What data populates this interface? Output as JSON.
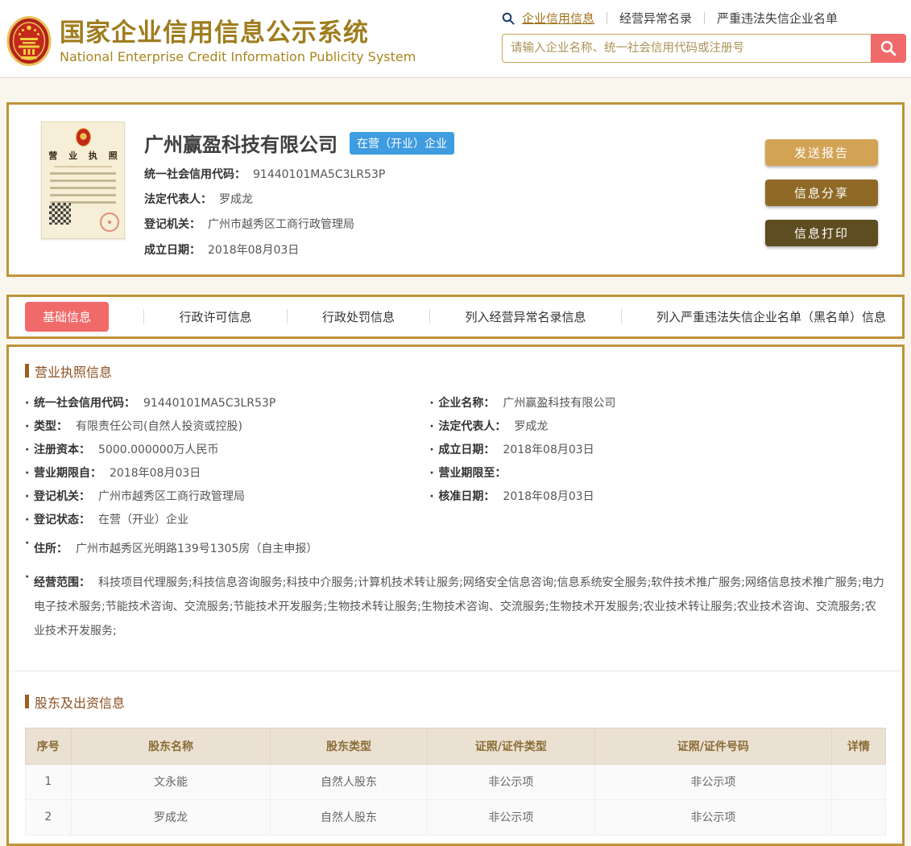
{
  "header": {
    "site_title": "国家企业信用信息公示系统",
    "site_subtitle": "National Enterprise Credit Information Publicity System",
    "nav_links": [
      {
        "label": "企业信用信息",
        "active": true
      },
      {
        "label": "经营异常名录",
        "active": false
      },
      {
        "label": "严重违法失信企业名单",
        "active": false
      }
    ],
    "search": {
      "placeholder": "请输入企业名称、统一社会信用代码或注册号"
    }
  },
  "company_card": {
    "license_title": "营 业 执 照",
    "company_name": "广州赢盈科技有限公司",
    "status_badge": "在营（开业）企业",
    "fields": [
      {
        "label": "统一社会信用代码：",
        "value": "91440101MA5C3LR53P"
      },
      {
        "label": "法定代表人：",
        "value": "罗成龙"
      },
      {
        "label": "登记机关：",
        "value": "广州市越秀区工商行政管理局"
      },
      {
        "label": "成立日期：",
        "value": "2018年08月03日"
      }
    ],
    "buttons": {
      "send_report": "发送报告",
      "share_info": "信息分享",
      "print_info": "信息打印"
    }
  },
  "tabs": [
    {
      "label": "基础信息",
      "active": true
    },
    {
      "label": "行政许可信息",
      "active": false
    },
    {
      "label": "行政处罚信息",
      "active": false
    },
    {
      "label": "列入经营异常名录信息",
      "active": false
    },
    {
      "label": "列入严重违法失信企业名单（黑名单）信息",
      "active": false
    }
  ],
  "license_section": {
    "title": "营业执照信息",
    "left_fields": [
      {
        "label": "统一社会信用代码：",
        "value": "91440101MA5C3LR53P"
      },
      {
        "label": "类型：",
        "value": "有限责任公司(自然人投资或控股)"
      },
      {
        "label": "注册资本：",
        "value": "5000.000000万人民币"
      },
      {
        "label": "营业期限自：",
        "value": "2018年08月03日"
      },
      {
        "label": "登记机关：",
        "value": "广州市越秀区工商行政管理局"
      },
      {
        "label": "登记状态：",
        "value": "在营（开业）企业"
      }
    ],
    "right_fields": [
      {
        "label": "企业名称：",
        "value": "广州赢盈科技有限公司"
      },
      {
        "label": "法定代表人：",
        "value": "罗成龙"
      },
      {
        "label": "成立日期：",
        "value": "2018年08月03日"
      },
      {
        "label": "营业期限至：",
        "value": ""
      },
      {
        "label": "核准日期：",
        "value": "2018年08月03日"
      }
    ],
    "full_fields": [
      {
        "label": "住所：",
        "value": "广州市越秀区光明路139号1305房（自主申报）"
      },
      {
        "label": "经营范围：",
        "value": "科技项目代理服务;科技信息咨询服务;科技中介服务;计算机技术转让服务;网络安全信息咨询;信息系统安全服务;软件技术推广服务;网络信息技术推广服务;电力电子技术服务;节能技术咨询、交流服务;节能技术开发服务;生物技术转让服务;生物技术咨询、交流服务;生物技术开发服务;农业技术转让服务;农业技术咨询、交流服务;农业技术开发服务;"
      }
    ]
  },
  "shareholders_section": {
    "title": "股东及出资信息",
    "headers": [
      "序号",
      "股东名称",
      "股东类型",
      "证照/证件类型",
      "证照/证件号码",
      "详情"
    ],
    "rows": [
      [
        "1",
        "文永能",
        "自然人股东",
        "非公示项",
        "非公示项",
        ""
      ],
      [
        "2",
        "罗成龙",
        "自然人股东",
        "非公示项",
        "非公示项",
        ""
      ]
    ]
  },
  "colors": {
    "brand_gold": "#9f7d1f",
    "card_border_gold": "#bf9339",
    "accent_red": "#f16a6a",
    "badge_blue": "#3f9ce0",
    "btn_send_report": "#d3a355",
    "btn_share_info": "#8e6a26",
    "btn_print_info": "#5e4d20",
    "table_header_bg": "#eae1d2",
    "section_title_brown": "#8b4f21"
  }
}
